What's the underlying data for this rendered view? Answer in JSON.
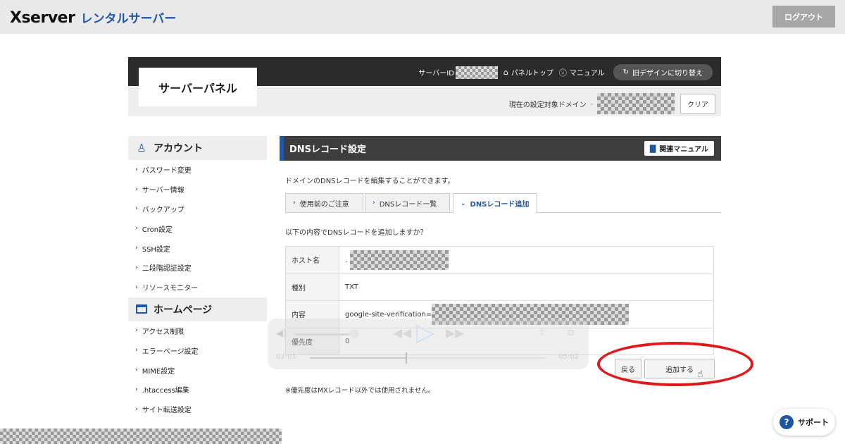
{
  "topbar": {
    "brand_main": "Xserver",
    "brand_sub": "レンタルサーバー",
    "logout": "ログアウト"
  },
  "panel": {
    "title": "サーバーパネル",
    "server_id_label": "サーバーID",
    "nav": [
      {
        "icon": "home-icon",
        "label": "パネルトップ"
      },
      {
        "icon": "help-circle-icon",
        "label": "マニュアル"
      }
    ],
    "switch_label": "旧デザインに切り替え",
    "domain_label": "現在の設定対象ドメイン",
    "clear_label": "クリア"
  },
  "sidebar": {
    "account": {
      "heading": "アカウント",
      "items": [
        "パスワード変更",
        "サーバー情報",
        "バックアップ",
        "Cron設定",
        "SSH設定",
        "二段階認証設定",
        "リソースモニター"
      ]
    },
    "homepage": {
      "heading": "ホームページ",
      "items": [
        "アクセス制限",
        "エラーページ設定",
        "MIME設定",
        ".htaccess編集",
        "サイト転送設定"
      ]
    }
  },
  "main": {
    "title": "DNSレコード設定",
    "manual_button": "関連マニュアル",
    "description": "ドメインのDNSレコードを編集することができます。",
    "tabs": [
      "使用前のご注意",
      "DNSレコード一覧",
      "DNSレコード追加"
    ],
    "active_tab": "DNSレコード追加",
    "question": "以下の内容でDNSレコードを追加しますか？",
    "rows": [
      {
        "key": "ホスト名",
        "value": "."
      },
      {
        "key": "種別",
        "value": "TXT"
      },
      {
        "key": "内容",
        "value": "google-site-verification="
      },
      {
        "key": "優先度",
        "value": "0"
      }
    ],
    "back_button": "戻る",
    "add_button": "追加する",
    "note": "※優先度はMXレコード以外では使用されません。"
  },
  "video": {
    "elapsed": "02:01",
    "remaining": "05:02",
    "progress": 0.29
  },
  "support": {
    "label": "サポート"
  },
  "colors": {
    "accent": "#1f56a8",
    "annotation": "#e3171b"
  }
}
